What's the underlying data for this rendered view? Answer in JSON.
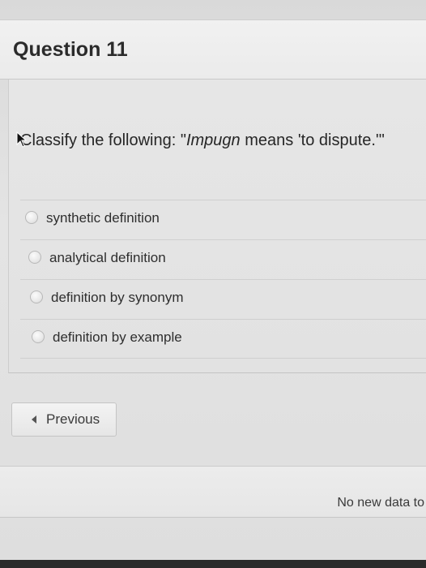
{
  "question": {
    "title": "Question 11",
    "prompt_prefix": "Classify the following: \"",
    "prompt_italic": "Impugn",
    "prompt_suffix": " means 'to dispute.'\""
  },
  "answers": [
    {
      "label": "synthetic definition"
    },
    {
      "label": "analytical definition"
    },
    {
      "label": "definition by synonym"
    },
    {
      "label": "definition by example"
    }
  ],
  "navigation": {
    "previous_label": "Previous"
  },
  "status": {
    "text": "No new data to"
  },
  "icons": {
    "previous": "caret-left-icon",
    "radio": "radio-button-icon",
    "cursor": "mouse-pointer-icon"
  }
}
